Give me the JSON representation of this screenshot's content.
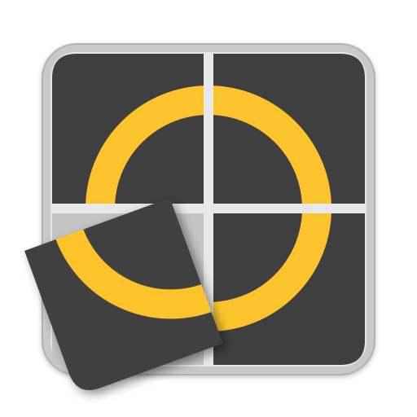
{
  "app_icon": {
    "icon_name": "sliding-puzzle-ring-icon",
    "grid": {
      "rows": 2,
      "cols": 2
    },
    "pieces": [
      {
        "id": "top-left",
        "state": "placed"
      },
      {
        "id": "top-right",
        "state": "placed"
      },
      {
        "id": "bottom-right",
        "state": "placed"
      },
      {
        "id": "bottom-left",
        "state": "lifted"
      }
    ],
    "colors": {
      "frame": "#c9c9c9",
      "frame_edge": "#b2b2b2",
      "empty_slot": "#c4c4c4",
      "gap": "#e8e8e8",
      "tile": "#3f3f3f",
      "ring": "#fcc42c"
    }
  }
}
